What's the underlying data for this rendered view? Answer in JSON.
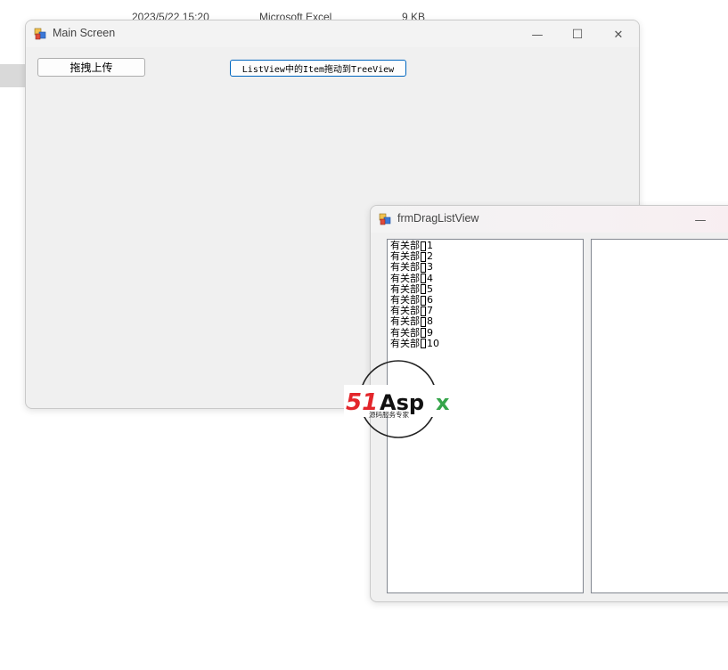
{
  "background": {
    "row": {
      "date": "2023/5/22 15:20",
      "type": "Microsoft Excel",
      "size": "9 KB"
    }
  },
  "main_window": {
    "title": "Main Screen",
    "buttons": {
      "drag_upload": "拖拽上传",
      "listview_to_treeview": "ListView中的Item拖动到TreeView"
    },
    "controls": {
      "minimize": "—",
      "maximize": "☐",
      "close": "✕"
    }
  },
  "drag_window": {
    "title": "frmDragListView",
    "controls": {
      "minimize": "—"
    },
    "list_items": [
      {
        "prefix": "有关部",
        "num": "1"
      },
      {
        "prefix": "有关部",
        "num": "2"
      },
      {
        "prefix": "有关部",
        "num": "3"
      },
      {
        "prefix": "有关部",
        "num": "4"
      },
      {
        "prefix": "有关部",
        "num": "5"
      },
      {
        "prefix": "有关部",
        "num": "6"
      },
      {
        "prefix": "有关部",
        "num": "7"
      },
      {
        "prefix": "有关部",
        "num": "8"
      },
      {
        "prefix": "有关部",
        "num": "9"
      },
      {
        "prefix": "有关部",
        "num": "10"
      }
    ]
  },
  "watermark": {
    "logo_text": "51Aspx",
    "tagline": "源码服务专家"
  },
  "colors": {
    "window_bg": "#f0f0f0",
    "accent_border": "#0067c0",
    "logo_red": "#e3262b",
    "logo_green": "#35a54a"
  }
}
